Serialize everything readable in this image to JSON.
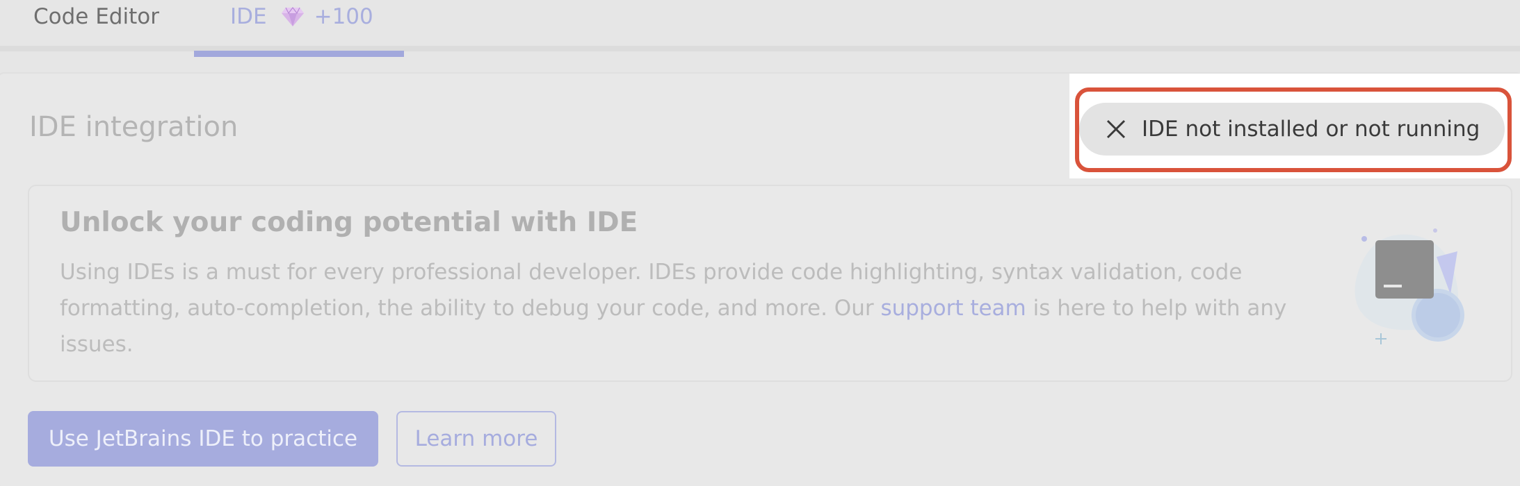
{
  "tabs": {
    "code_editor": "Code Editor",
    "ide": "IDE",
    "ide_reward": "+100"
  },
  "section": {
    "title": "IDE integration"
  },
  "status": {
    "text": "IDE not installed or not running"
  },
  "card": {
    "title": "Unlock your coding potential with IDE",
    "body_before_link": "Using IDEs is a must for every professional developer. IDEs provide code highlighting, syntax validation, code formatting, auto-completion, the ability to debug your code, and more. Our ",
    "link_text": "support team",
    "body_after_link": " is here to help with any issues."
  },
  "buttons": {
    "primary": "Use JetBrains IDE to practice",
    "secondary": "Learn more"
  },
  "icons": {
    "gem": "gem-icon",
    "close": "close-icon",
    "illustration": "ide-terminal-illustration"
  },
  "colors": {
    "accent": "#a6acde",
    "highlight_frame": "#d9533b",
    "background": "#e6e6e6"
  }
}
